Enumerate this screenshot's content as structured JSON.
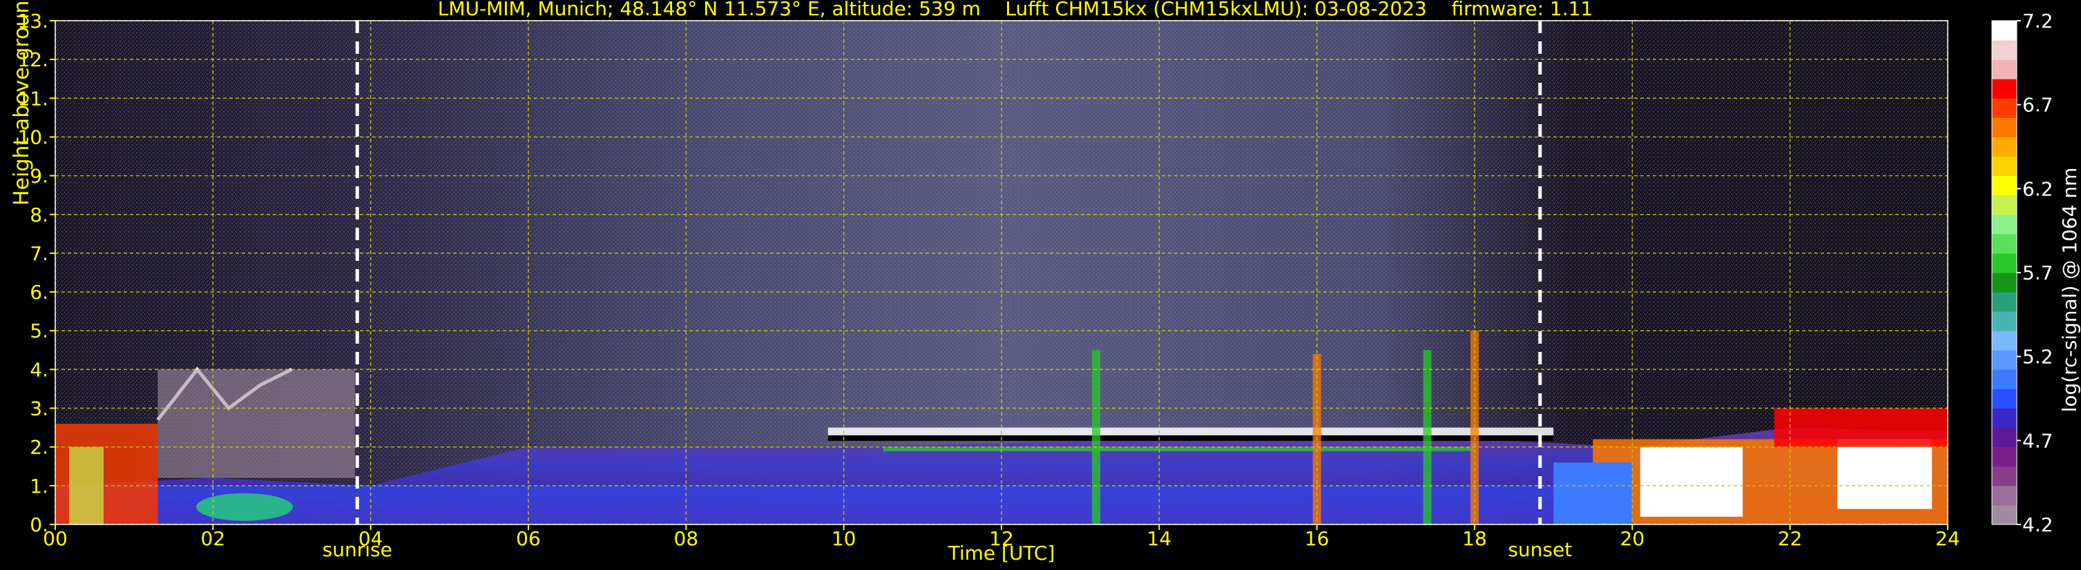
{
  "title": "LMU-MIM, Munich; 48.148° N 11.573° E, altitude: 539 m    Lufft CHM15kx (CHM15kxLMU): 03-08-2023    firmware: 1.11",
  "colors": {
    "background": "#000000",
    "text": "#ffff00",
    "grid": "#c8c800",
    "marker_line": "#ffffff"
  },
  "chart_data": {
    "type": "heatmap",
    "title": "LMU-MIM, Munich; 48.148° N 11.573° E, altitude: 539 m    Lufft CHM15kx (CHM15kxLMU): 03-08-2023    firmware: 1.11",
    "xlabel": "Time [UTC]",
    "ylabel": "Height above ground [km]",
    "xlim": [
      0,
      24
    ],
    "ylim": [
      0,
      13
    ],
    "x_ticks": [
      "00",
      "02",
      "04",
      "06",
      "08",
      "10",
      "12",
      "14",
      "16",
      "18",
      "20",
      "22",
      "24"
    ],
    "y_ticks": [
      "0.",
      "1.",
      "2.",
      "3.",
      "4.",
      "5.",
      "6.",
      "7.",
      "8.",
      "9.",
      "10.",
      "11.",
      "12.",
      "13."
    ],
    "grid": true,
    "annotations": [
      {
        "label": "sunrise",
        "x": 3.83
      },
      {
        "label": "sunset",
        "x": 18.83
      }
    ],
    "colorbar": {
      "label": "log(rc-signal) @ 1064 nm",
      "min": 4.2,
      "max": 7.2,
      "ticks": [
        "4.2",
        "4.7",
        "5.2",
        "5.7",
        "6.2",
        "6.7",
        "7.2"
      ],
      "colors": [
        "#a08ca0",
        "#9b6e9b",
        "#8a3c8a",
        "#7a1f8a",
        "#5a1a9a",
        "#3a28c8",
        "#2850ff",
        "#3c7aff",
        "#5a9aff",
        "#7ab8ff",
        "#4ab4b4",
        "#2aa07a",
        "#149614",
        "#2ac82a",
        "#5ae05a",
        "#8cf08c",
        "#c8f050",
        "#ffff00",
        "#ffd200",
        "#ffaa00",
        "#ff7800",
        "#ff3c00",
        "#ff0000",
        "#f0b4b4",
        "#f0d2d2",
        "#ffffff"
      ]
    },
    "features": [
      {
        "name": "mixing-layer-aerosol",
        "x": [
          0,
          24
        ],
        "y_top_km": [
          1.0,
          1.2,
          1.0,
          2.0,
          2.0,
          2.0,
          2.1,
          2.2,
          2.3,
          2.2,
          2.0,
          2.5,
          2.4
        ]
      },
      {
        "name": "cloud-layer",
        "x": [
          9.8,
          19.0
        ],
        "y_km": 2.2
      },
      {
        "name": "early-clouds",
        "x": [
          0,
          3.0
        ],
        "y_km": [
          2.6,
          4.0
        ]
      },
      {
        "name": "evening-clouds",
        "x": [
          20.0,
          24.0
        ],
        "y_km": [
          1.0,
          3.0
        ]
      }
    ]
  }
}
